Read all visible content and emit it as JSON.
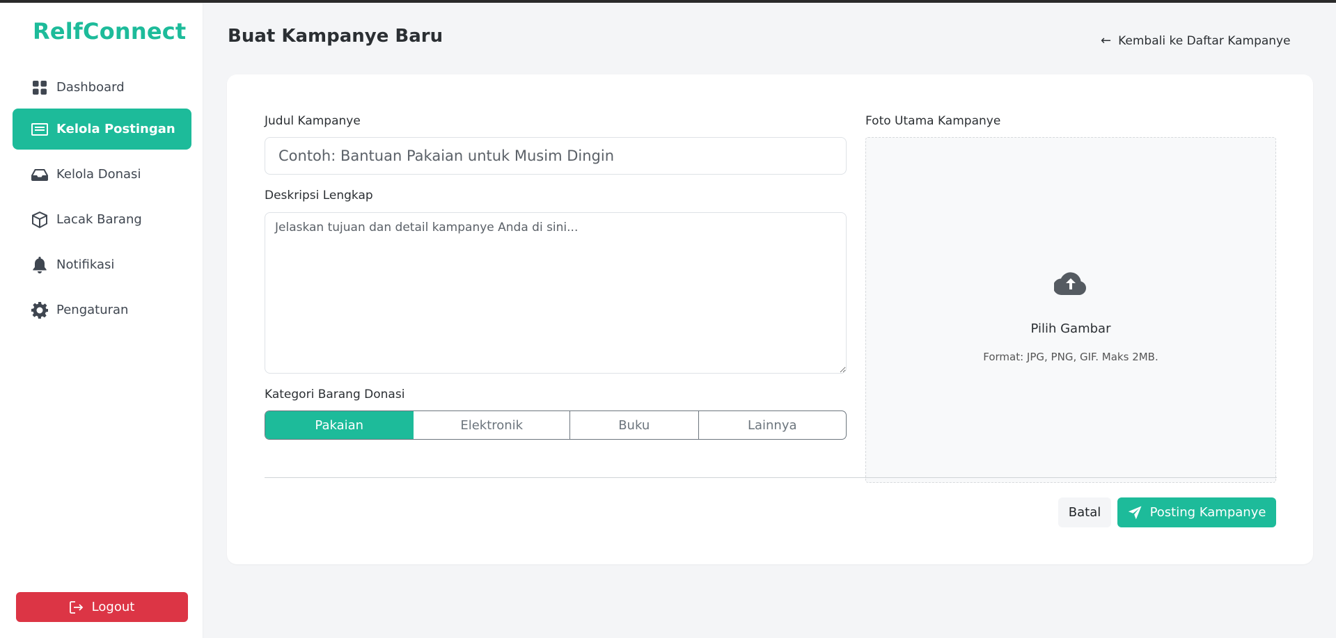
{
  "app": {
    "brand": "RelfConnect"
  },
  "sidebar": {
    "items": [
      {
        "label": "Dashboard",
        "icon": "grid-icon"
      },
      {
        "label": "Kelola Postingan",
        "icon": "list-icon",
        "active": true
      },
      {
        "label": "Kelola Donasi",
        "icon": "inbox-icon"
      },
      {
        "label": "Lacak Barang",
        "icon": "box-icon"
      },
      {
        "label": "Notifikasi",
        "icon": "bell-icon"
      },
      {
        "label": "Pengaturan",
        "icon": "gear-icon"
      }
    ],
    "logout_label": "Logout"
  },
  "header": {
    "title": "Buat Kampanye Baru",
    "back_link": "Kembali ke Daftar Kampanye"
  },
  "form": {
    "title_label": "Judul Kampanye",
    "title_placeholder": "Contoh: Bantuan Pakaian untuk Musim Dingin",
    "title_value": "",
    "description_label": "Deskripsi Lengkap",
    "description_placeholder": "Jelaskan tujuan dan detail kampanye Anda di sini...",
    "description_value": "",
    "category_label": "Kategori Barang Donasi",
    "categories": [
      "Pakaian",
      "Elektronik",
      "Buku",
      "Lainnya"
    ],
    "selected_category": "Pakaian",
    "photo_label": "Foto Utama Kampanye",
    "upload_title": "Pilih Gambar",
    "upload_hint": "Format: JPG, PNG, GIF. Maks 2MB."
  },
  "actions": {
    "cancel_label": "Batal",
    "submit_label": "Posting Kampanye"
  },
  "colors": {
    "accent": "#1dbb9a",
    "danger": "#dc3545",
    "background": "#f4f5f7"
  }
}
